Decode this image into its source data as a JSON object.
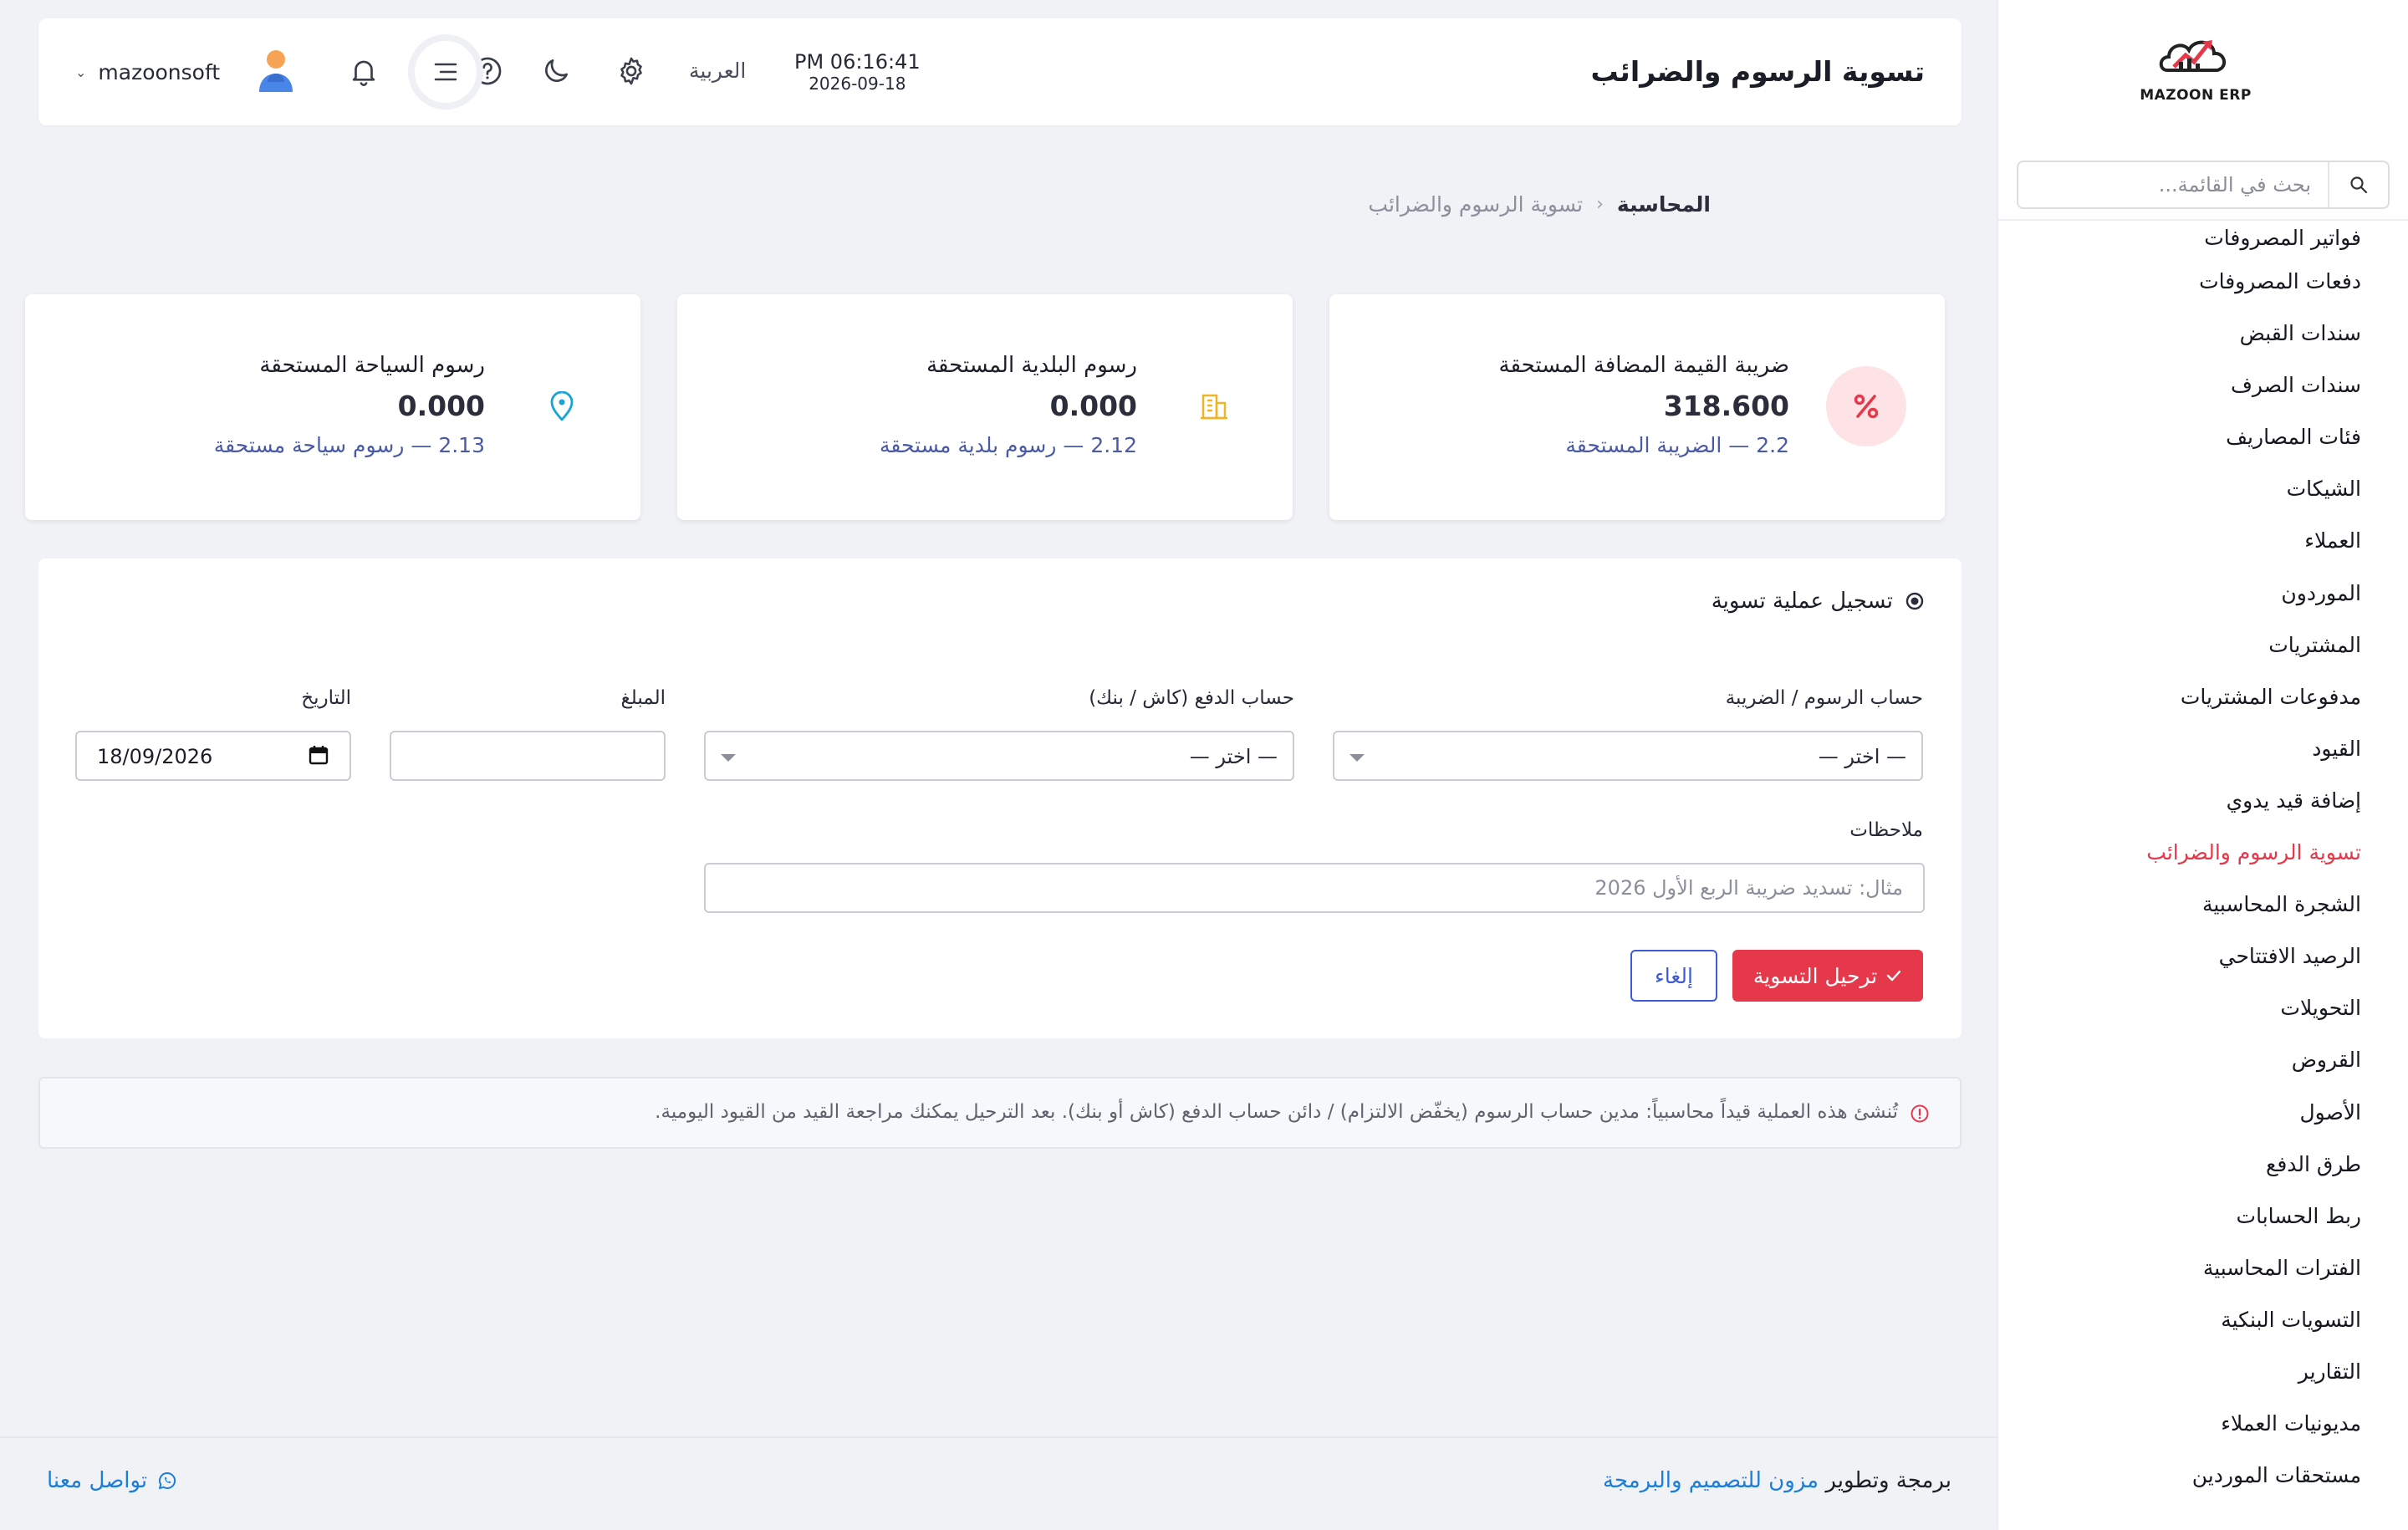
{
  "app": {
    "logo_text": "MAZOON ERP"
  },
  "sidebar": {
    "search_placeholder": "بحث في القائمة...",
    "items": [
      {
        "label": "فواتير المصروفات"
      },
      {
        "label": "دفعات المصروفات"
      },
      {
        "label": "سندات القبض"
      },
      {
        "label": "سندات الصرف"
      },
      {
        "label": "فئات المصاريف"
      },
      {
        "label": "الشيكات"
      },
      {
        "label": "العملاء"
      },
      {
        "label": "الموردون"
      },
      {
        "label": "المشتريات"
      },
      {
        "label": "مدفوعات المشتريات"
      },
      {
        "label": "القيود"
      },
      {
        "label": "إضافة قيد يدوي"
      },
      {
        "label": "تسوية الرسوم والضرائب",
        "active": true
      },
      {
        "label": "الشجرة المحاسبية"
      },
      {
        "label": "الرصيد الافتتاحي"
      },
      {
        "label": "التحويلات"
      },
      {
        "label": "القروض"
      },
      {
        "label": "الأصول"
      },
      {
        "label": "طرق الدفع"
      },
      {
        "label": "ربط الحسابات"
      },
      {
        "label": "الفترات المحاسبية"
      },
      {
        "label": "التسويات البنكية"
      },
      {
        "label": "التقارير"
      },
      {
        "label": "مديونيات العملاء"
      },
      {
        "label": "مستحقات الموردين"
      }
    ]
  },
  "header": {
    "title": "تسوية الرسوم والضرائب",
    "time": "PM 06:16:41",
    "date": "2026-09-18",
    "language": "العربية",
    "username": "mazoonsoft"
  },
  "breadcrumb": {
    "root": "المحاسبة",
    "separator": "‹",
    "current": "تسوية الرسوم والضرائب"
  },
  "stats": [
    {
      "title": "ضريبة القيمة المضافة المستحقة",
      "value": "318.600",
      "link": "2.2 — الضريبة المستحقة",
      "icon": "percent-icon",
      "color": "#e5384a",
      "bg": "#fde3e5"
    },
    {
      "title": "رسوم البلدية المستحقة",
      "value": "0.000",
      "link": "2.12 — رسوم بلدية مستحقة",
      "icon": "building-icon",
      "color": "#f0b429"
    },
    {
      "title": "رسوم السياحة المستحقة",
      "value": "0.000",
      "link": "2.13 — رسوم سياحة مستحقة",
      "icon": "map-pin-icon",
      "color": "#1aa3d6"
    }
  ],
  "form": {
    "title": "تسجيل عملية تسوية",
    "fee_account_label": "حساب الرسوم / الضريبة",
    "fee_account_value": "— اختر —",
    "payment_account_label": "حساب الدفع (كاش / بنك)",
    "payment_account_value": "— اختر —",
    "amount_label": "المبلغ",
    "amount_value": "",
    "date_label": "التاريخ",
    "date_value": "18/09/2026",
    "notes_label": "ملاحظات",
    "notes_placeholder": "مثال: تسديد ضريبة الربع الأول 2026",
    "submit_label": "ترحيل التسوية",
    "cancel_label": "إلغاء"
  },
  "info_note": "تُنشئ هذه العملية قيداً محاسبياً: مدين حساب الرسوم (يخفّض الالتزام) / دائن حساب الدفع (كاش أو بنك). بعد الترحيل يمكنك مراجعة القيد من القيود اليومية.",
  "footer": {
    "credit_prefix": "برمجة وتطوير",
    "credit_link": "مزون للتصميم والبرمجة",
    "contact": "تواصل معنا"
  },
  "colors": {
    "accent_red": "#e5384a",
    "link_blue": "#1d7ed8",
    "indigo": "#3d5bd9"
  }
}
